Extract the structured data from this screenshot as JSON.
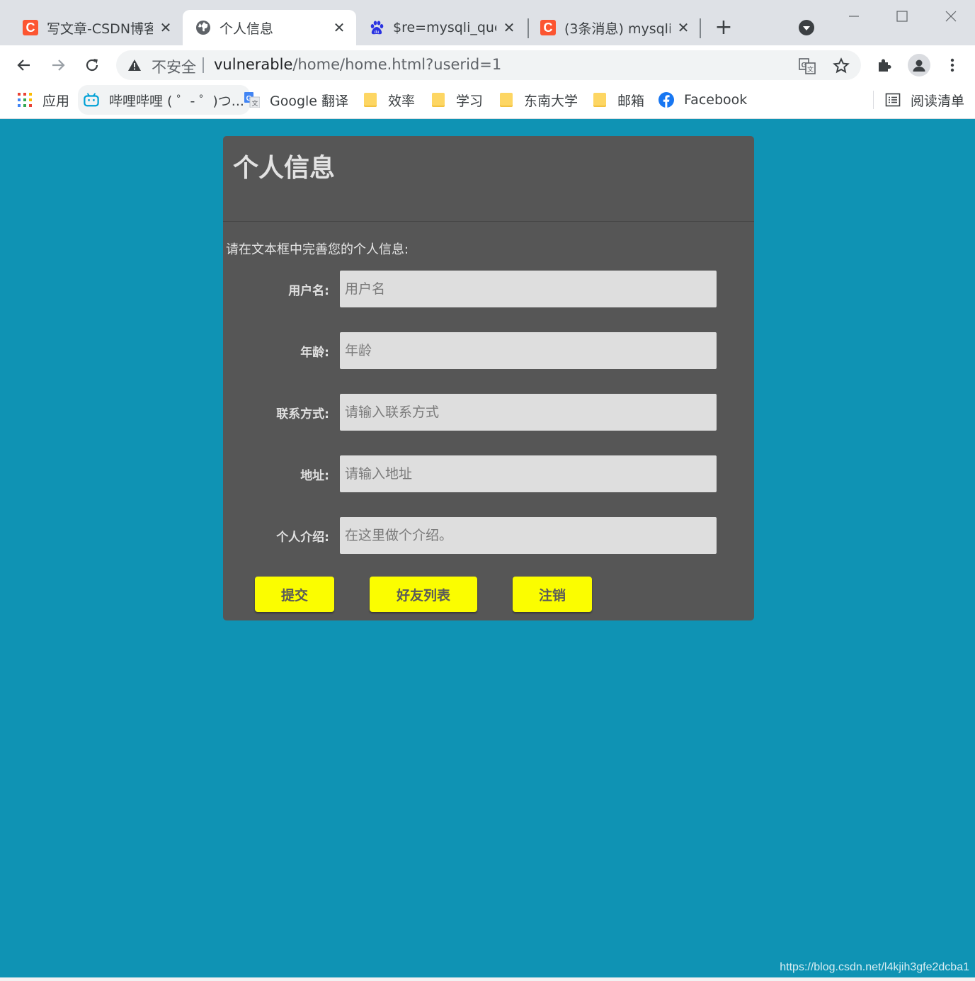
{
  "browser": {
    "tabs": [
      {
        "title": "写文章-CSDN博客",
        "icon": "csdn-icon",
        "active": false
      },
      {
        "title": "个人信息",
        "icon": "globe-icon",
        "active": true
      },
      {
        "title": "$re=mysqli_quer",
        "icon": "baidu-paw-icon",
        "active": false
      },
      {
        "title": "(3条消息) mysqli_",
        "icon": "csdn-icon",
        "active": false
      }
    ],
    "csdn_letter": "C",
    "new_tab_icon": "plus-icon",
    "omnibox": {
      "security_label": "不安全",
      "url_host": "vulnerable",
      "url_path": "/home/home.html?userid=1"
    },
    "bookmarks": [
      {
        "label": "应用",
        "icon": "apps-grid-icon"
      },
      {
        "label": "哔哩哔哩 ( ゜- ゜)つ...",
        "icon": "bilibili-icon"
      },
      {
        "label": "Google 翻译",
        "icon": "google-translate-icon"
      },
      {
        "label": "效率",
        "icon": "folder-icon"
      },
      {
        "label": "学习",
        "icon": "folder-icon"
      },
      {
        "label": "东南大学",
        "icon": "folder-icon"
      },
      {
        "label": "邮箱",
        "icon": "folder-icon"
      },
      {
        "label": "Facebook",
        "icon": "facebook-icon"
      }
    ],
    "reading_list": "阅读清单"
  },
  "page": {
    "title": "个人信息",
    "instruction": "请在文本框中完善您的个人信息:",
    "fields": [
      {
        "label": "用户名:",
        "placeholder": "用户名"
      },
      {
        "label": "年龄:",
        "placeholder": "年龄"
      },
      {
        "label": "联系方式:",
        "placeholder": "请输入联系方式"
      },
      {
        "label": "地址:",
        "placeholder": "请输入地址"
      },
      {
        "label": "个人介绍:",
        "placeholder": "在这里做个介绍。"
      }
    ],
    "buttons": {
      "submit": "提交",
      "friends": "好友列表",
      "logout": "注销"
    },
    "colors": {
      "background": "#0f93b4",
      "card": "#565656",
      "button": "#fbfd00"
    }
  },
  "watermark": "https://blog.csdn.net/l4kjih3gfe2dcba1"
}
